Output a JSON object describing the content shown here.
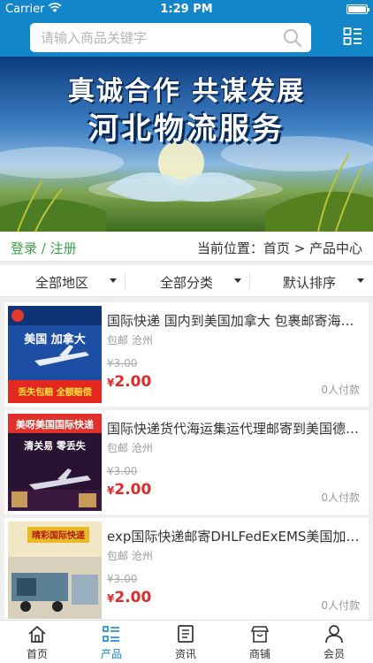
{
  "status_bar": {
    "carrier": "Carrier",
    "time": "1:29 PM"
  },
  "search": {
    "placeholder": "请输入商品关键字"
  },
  "banner": {
    "line1": "真诚合作  共谋发展",
    "line2": "河北物流服务"
  },
  "auth": {
    "login": "登录",
    "separator": " / ",
    "register": "注册"
  },
  "breadcrumb": {
    "text": "当前位置：首页 > 产品中心"
  },
  "filters": [
    {
      "label": "全部地区"
    },
    {
      "label": "全部分类"
    },
    {
      "label": "默认排序"
    }
  ],
  "products": [
    {
      "title": "国际快递 国内到美国加拿大 包裹邮寄海外专线",
      "location": "包邮  沧州",
      "old_price": "¥3.00",
      "price_symbol": "¥",
      "price": "2.00",
      "paid": "0人付款",
      "thumb": {
        "line1": "美国  加拿大",
        "line2": "丢失包赔 全额赔偿"
      }
    },
    {
      "title": "国际快递货代海运集运代理邮寄到美国德国日本",
      "location": "包邮  沧州",
      "old_price": "¥3.00",
      "price_symbol": "¥",
      "price": "2.00",
      "paid": "0人付款",
      "thumb": {
        "line1": "美呀美国国际快递",
        "line2": "清关易  零丢失"
      }
    },
    {
      "title": "exp国际快递邮寄DHLFedExEMS美国加拿大专线",
      "location": "包邮  沧州",
      "old_price": "¥3.00",
      "price_symbol": "¥",
      "price": "2.00",
      "paid": "0人付款",
      "thumb": {
        "line1": "晴彩国际快递",
        "line2": ""
      }
    }
  ],
  "tabs": [
    {
      "label": "首页",
      "icon": "home-icon",
      "active": false
    },
    {
      "label": "产品",
      "icon": "list-icon",
      "active": true
    },
    {
      "label": "资讯",
      "icon": "news-icon",
      "active": false
    },
    {
      "label": "商铺",
      "icon": "store-icon",
      "active": false
    },
    {
      "label": "会员",
      "icon": "user-icon",
      "active": false
    }
  ],
  "colors": {
    "brand_blue": "#1386c9",
    "price_red": "#e02a2a",
    "link_green": "#3aa34a"
  }
}
